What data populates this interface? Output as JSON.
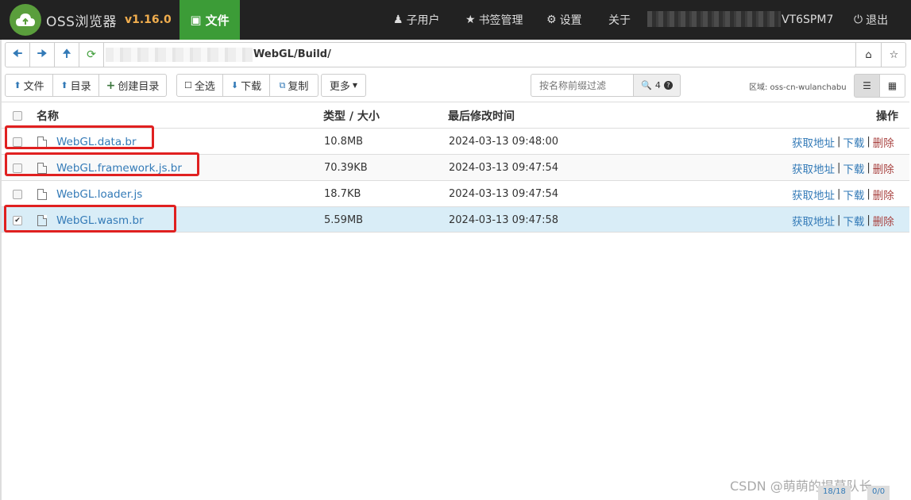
{
  "header": {
    "brand": "OSS浏览器",
    "version": "v1.16.0",
    "nav_files": "文件",
    "subusers": "子用户",
    "bookmarks": "书签管理",
    "settings": "设置",
    "about": "关于",
    "account_suffix": "VT6SPM7",
    "logout": "退出"
  },
  "address": {
    "path": "WebGL/Build/"
  },
  "toolbar": {
    "upload_file": "文件",
    "upload_dir": "目录",
    "create_dir": "创建目录",
    "select_all": "全选",
    "download": "下载",
    "copy": "复制",
    "more": "更多",
    "filter_placeholder": "按名称前缀过滤",
    "count": "4",
    "region_label": "区域: oss-cn-wulanchabu"
  },
  "table": {
    "headers": {
      "name": "名称",
      "type_size": "类型 / 大小",
      "modified": "最后修改时间",
      "actions": "操作"
    },
    "rows": [
      {
        "name": "WebGL.data.br",
        "size": "10.8MB",
        "modified": "2024-03-13 09:48:00",
        "checked": false,
        "selected": false
      },
      {
        "name": "WebGL.framework.js.br",
        "size": "70.39KB",
        "modified": "2024-03-13 09:47:54",
        "checked": false,
        "selected": false
      },
      {
        "name": "WebGL.loader.js",
        "size": "18.7KB",
        "modified": "2024-03-13 09:47:54",
        "checked": false,
        "selected": false
      },
      {
        "name": "WebGL.wasm.br",
        "size": "5.59MB",
        "modified": "2024-03-13 09:47:58",
        "checked": true,
        "selected": true
      }
    ],
    "actions": {
      "get_url": "获取地址",
      "download": "下载",
      "delete": "删除"
    }
  },
  "footer": {
    "watermark": "CSDN @萌萌的提莫队长",
    "upload_count": "18/18",
    "download_count": "0/0"
  },
  "colors": {
    "navbar": "#222222",
    "active_tab": "#3c9c37",
    "version": "#f0ad4e",
    "link": "#337ab7",
    "delete": "#a94442",
    "selected_row": "#d9edf7",
    "highlight_box": "#e02020"
  }
}
